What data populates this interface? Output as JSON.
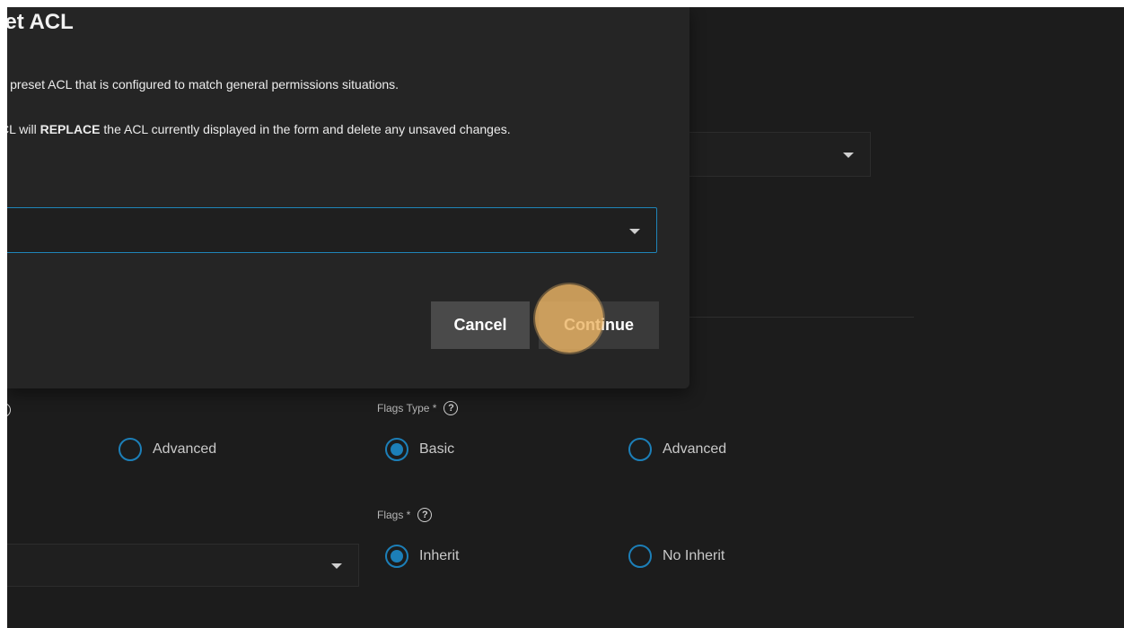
{
  "dialog": {
    "title": "set ACL",
    "description": "ads a preset ACL that is configured to match general permissions situations.",
    "warning_before": "CL will ",
    "warning_strong": "REPLACE",
    "warning_after": " the ACL currently displayed in the form and delete any unsaved changes.",
    "preset_select_value": "",
    "cancel_label": "Cancel",
    "continue_label": "Continue"
  },
  "form": {
    "left_advanced_label": "Advanced",
    "flags_type_label": "Flags Type *",
    "flags_type_options": [
      "Basic",
      "Advanced"
    ],
    "flags_type_selected": "Basic",
    "flags_label": "Flags *",
    "flags_options": [
      "Inherit",
      "No Inherit"
    ],
    "flags_selected": "Inherit"
  },
  "colors": {
    "accent": "#1c7fb8",
    "highlight": "#ecb565",
    "background": "#1c1c1c",
    "dialog": "#252525"
  }
}
